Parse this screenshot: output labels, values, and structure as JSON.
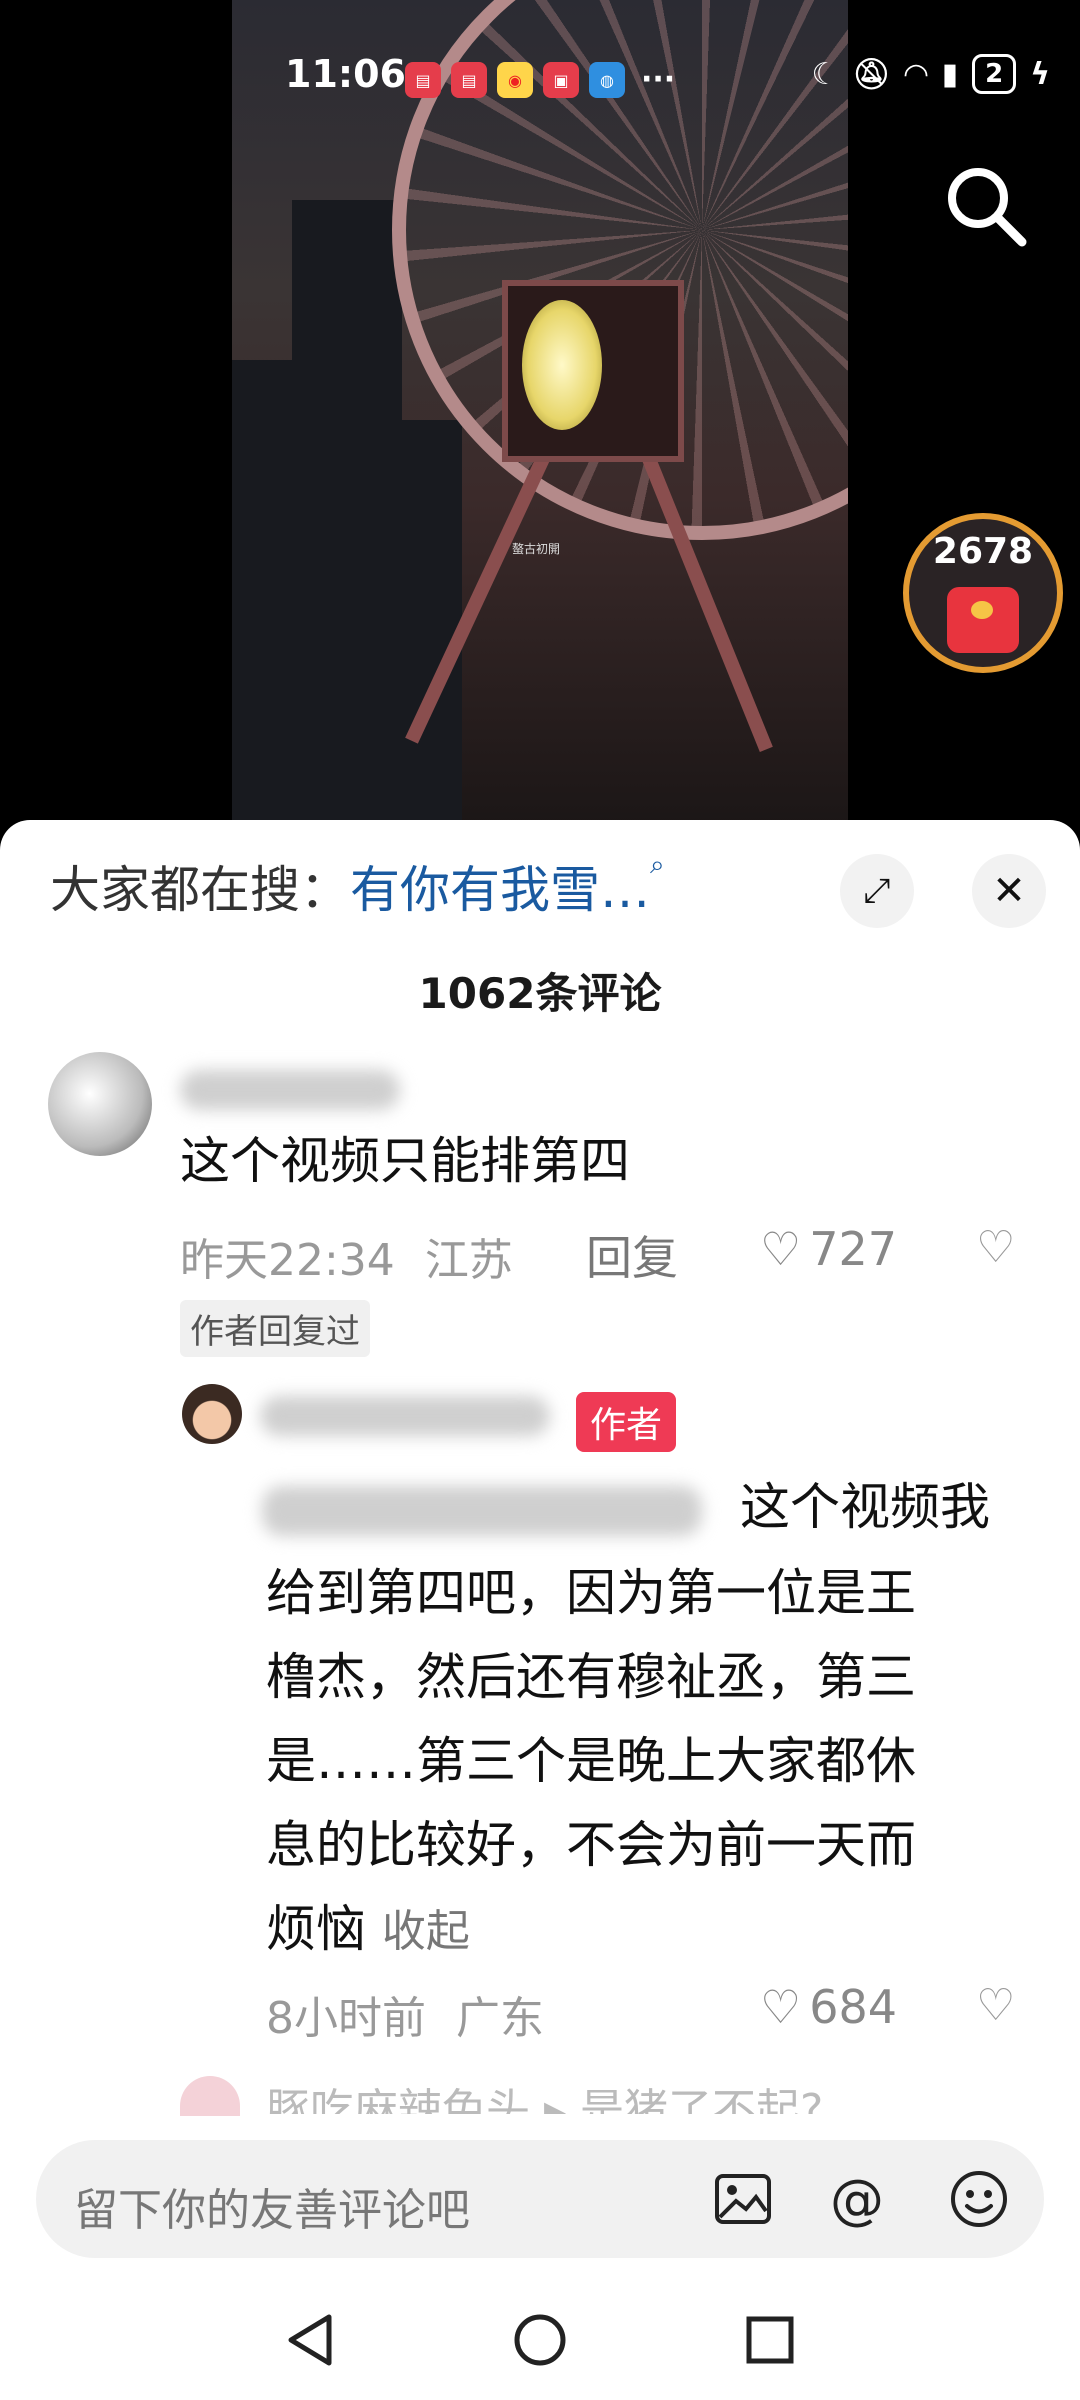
{
  "status_bar": {
    "time": "11:06",
    "app_icons": [
      "book-icon",
      "book-icon",
      "weibo-icon",
      "news-icon",
      "browser-icon"
    ],
    "more": "···",
    "battery": "2"
  },
  "video": {
    "watermark": "螯古初開"
  },
  "red_packet": {
    "count": "2678"
  },
  "search_suggest": {
    "prefix": "大家都在搜：",
    "term": "有你有我雪…",
    "icon": "search-icon"
  },
  "comments_header": {
    "count_label": "1062条评论"
  },
  "comment1": {
    "text": "这个视频只能排第四",
    "time": "昨天22:34",
    "location": "江苏",
    "reply": "回复",
    "likes": "727",
    "author_replied": "作者回复过"
  },
  "reply1": {
    "author_tag": "作者",
    "text_line1": "这个视频我",
    "text_line2": "给到第四吧，因为第一位是王",
    "text_line3": "橹杰，然后还有穆祉丞，第三",
    "text_line4": "是……第三个是晚上大家都休",
    "text_line5": "息的比较好，不会为前一天而",
    "text_line6": "烦恼",
    "collapse": "收起",
    "time": "8小时前",
    "location": "广东",
    "likes": "684"
  },
  "next_comment_partial": "豚吃麻辣兔头    ▸ 是猪了不起?",
  "input_bar": {
    "placeholder": "留下你的友善评论吧"
  },
  "colors": {
    "accent_red": "#ef3a55",
    "link_blue": "#1a5aa0"
  }
}
